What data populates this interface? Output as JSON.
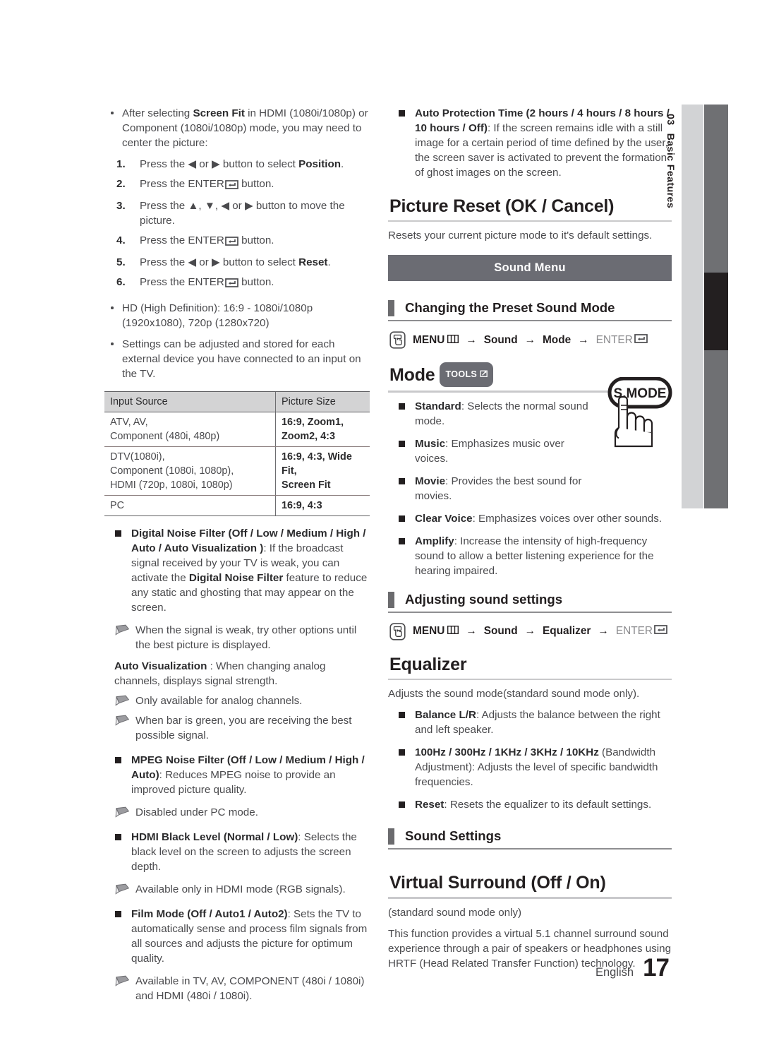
{
  "sidebar": {
    "chapter_number": "03",
    "chapter_title": "Basic Features"
  },
  "footer": {
    "language": "English",
    "page_number": "17"
  },
  "left_column": {
    "bullet_screen_fit": "After selecting ",
    "bullet_screen_fit_b1": "Screen Fit",
    "bullet_screen_fit_rest": " in HDMI (1080i/1080p) or Component (1080i/1080p) mode, you may need to center the picture:",
    "steps": [
      {
        "num": "1.",
        "pre": "Press the ◀ or ▶ button to select ",
        "strong": "Position",
        "post": "."
      },
      {
        "num": "2.",
        "pre": "Press the ",
        "enter": "ENTER",
        "post": " button."
      },
      {
        "num": "3.",
        "pre": "Press the ▲, ▼, ◀ or ▶ button to move the picture.",
        "post": ""
      },
      {
        "num": "4.",
        "pre": "Press the ",
        "enter": "ENTER",
        "post": " button."
      },
      {
        "num": "5.",
        "pre": "Press the ◀ or ▶ button to select ",
        "strong": "Reset",
        "post": "."
      },
      {
        "num": "6.",
        "pre": "Press the ",
        "enter": "ENTER",
        "post": " button."
      }
    ],
    "bullet_hd": "HD (High Definition): 16:9 - 1080i/1080p (1920x1080), 720p (1280x720)",
    "bullet_settings": "Settings can be adjusted and stored for each external device you have connected to an input on the TV.",
    "table": {
      "headers": [
        "Input Source",
        "Picture Size"
      ],
      "rows": [
        {
          "source": "ATV, AV,\nComponent (480i, 480p)",
          "size": "16:9, Zoom1,\nZoom2, 4:3"
        },
        {
          "source": "DTV(1080i),\nComponent (1080i, 1080p),\nHDMI (720p, 1080i, 1080p)",
          "size": "16:9, 4:3, Wide Fit,\nScreen Fit"
        },
        {
          "source": "PC",
          "size": "16:9, 4:3"
        }
      ]
    },
    "dnf": {
      "title": "Digital Noise Filter (Off / Low / Medium / High / Auto / Auto Visualization )",
      "body_1": ": If the broadcast signal received by your TV is weak, you can activate the ",
      "body_b": "Digital Noise Filter",
      "body_2": " feature to reduce any static and ghosting that may appear on the screen.",
      "note": "When the signal is weak, try other options until the best picture is displayed."
    },
    "auto_vis": {
      "title": "Auto Visualization",
      "body": " : When changing analog channels, displays signal strength.",
      "note_1": "Only available for analog channels.",
      "note_2": "When bar is green, you are receiving the best possible signal."
    },
    "mpeg": {
      "title": "MPEG Noise Filter (Off / Low / Medium / High / Auto)",
      "body": ": Reduces MPEG noise to provide an improved picture quality.",
      "note": "Disabled under PC mode."
    },
    "hdmi_black": {
      "title": "HDMI Black Level (Normal / Low)",
      "body": ": Selects the black level on the screen to adjusts the screen depth.",
      "note": "Available only in HDMI mode (RGB signals)."
    },
    "film_mode": {
      "title": "Film Mode (Off / Auto1 / Auto2)",
      "body": ": Sets the TV to automatically sense and process film signals from all sources and adjusts the picture for optimum quality.",
      "note": "Available in TV, AV, COMPONENT (480i / 1080i) and HDMI (480i / 1080i)."
    }
  },
  "right_column": {
    "auto_protection": {
      "title": "Auto Protection Time (2 hours / 4 hours / 8 hours / 10 hours / Off)",
      "body": ": If the screen remains idle with a still image for a certain period of time defined by the user, the screen saver is activated to prevent the formation of ghost images on the screen."
    },
    "picture_reset": {
      "heading": "Picture Reset (OK / Cancel)",
      "body": "Resets your current picture mode to it's default settings."
    },
    "sound_menu_banner": "Sound Menu",
    "preset_sound": {
      "heading": "Changing the Preset Sound Mode",
      "path": {
        "menu": "MENU",
        "s1": "Sound",
        "s2": "Mode",
        "enter": "ENTER",
        "arrow": "→"
      }
    },
    "mode": {
      "heading": "Mode",
      "tools_label": "TOOLS",
      "items": [
        {
          "name": "Standard",
          "desc": ": Selects the normal sound mode."
        },
        {
          "name": "Music",
          "desc": ": Emphasizes music over voices."
        },
        {
          "name": "Movie",
          "desc": ": Provides the best sound for movies."
        },
        {
          "name": "Clear Voice",
          "desc": ": Emphasizes voices over other sounds."
        },
        {
          "name": "Amplify",
          "desc": ": Increase the intensity of high-frequency sound to allow a better listening experience for the hearing impaired."
        }
      ],
      "remote_button_label": "S.MODE"
    },
    "adjusting_sound": {
      "heading": "Adjusting sound settings",
      "path": {
        "menu": "MENU",
        "s1": "Sound",
        "s2": "Equalizer",
        "enter": "ENTER",
        "arrow": "→"
      }
    },
    "equalizer": {
      "heading": "Equalizer",
      "intro": "Adjusts the sound mode(standard sound mode only).",
      "items": [
        {
          "name": "Balance L/R",
          "desc": ": Adjusts the balance between the right and left speaker."
        },
        {
          "name": "100Hz / 300Hz / 1KHz / 3KHz / 10KHz",
          "desc": " (Bandwidth Adjustment): Adjusts the level of specific bandwidth frequencies."
        },
        {
          "name": "Reset",
          "desc": ": Resets the equalizer to its default settings."
        }
      ]
    },
    "sound_settings": {
      "heading": "Sound Settings"
    },
    "virtual_surround": {
      "heading": "Virtual Surround (Off / On)",
      "line_1": "(standard sound mode only)",
      "line_2": "This function provides a virtual 5.1 channel surround sound experience through a pair of speakers or headphones using HRTF (Head Related Transfer Function) technology."
    }
  },
  "colors": {
    "banner_gray": "#6b6c73",
    "tab_gray": "#d2d3d5",
    "strip_gray": "#6f7073",
    "strip_active": "#231f20",
    "text": "#4a4a4d"
  }
}
